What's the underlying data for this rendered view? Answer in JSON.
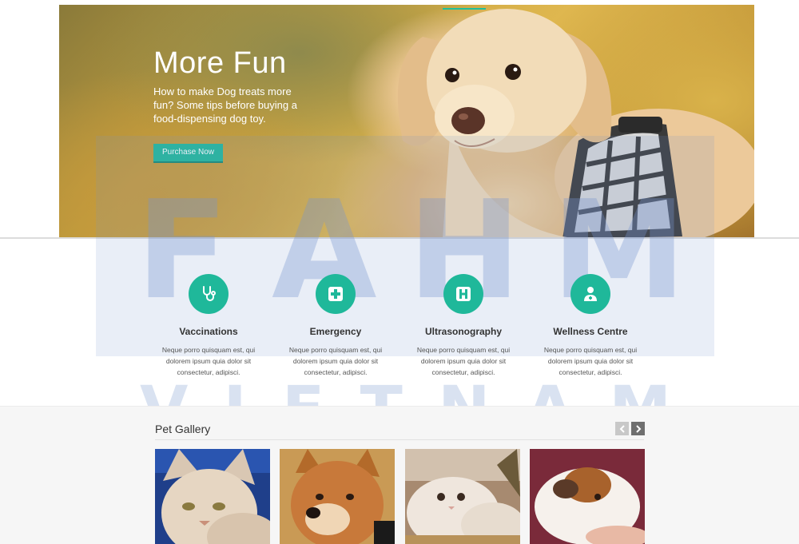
{
  "hero": {
    "title": "More Fun",
    "text": "How to make Dog treats more fun? Some tips before buying a food-dispensing dog toy.",
    "button_label": "Purchase Now",
    "accent": "#1fbf9c"
  },
  "services": [
    {
      "icon": "stethoscope-icon",
      "title": "Vaccinations",
      "text": "Neque porro quisquam est, qui dolorem ipsum quia dolor sit consectetur, adipisci."
    },
    {
      "icon": "medical-cross-icon",
      "title": "Emergency",
      "text": "Neque porro quisquam est, qui dolorem ipsum quia dolor sit consectetur, adipisci."
    },
    {
      "icon": "hospital-icon",
      "title": "Ultrasonography",
      "text": "Neque porro quisquam est, qui dolorem ipsum quia dolor sit consectetur, adipisci."
    },
    {
      "icon": "doctor-icon",
      "title": "Wellness Centre",
      "text": "Neque porro quisquam est, qui dolorem ipsum quia dolor sit consectetur, adipisci."
    }
  ],
  "gallery": {
    "title": "Pet Gallery",
    "prev_icon": "chevron-left-icon",
    "next_icon": "chevron-right-icon",
    "photos": [
      "cat-photo",
      "shiba-puppy-photo",
      "persian-kitten-photo",
      "guinea-pig-photo"
    ]
  },
  "watermark": {
    "letters": [
      "F",
      "A",
      "H",
      "M"
    ],
    "word": [
      "V",
      "I",
      "E",
      "T",
      "N",
      "A",
      "M"
    ]
  },
  "colors": {
    "accent": "#1fb89a",
    "watermark": "#7896cd"
  }
}
